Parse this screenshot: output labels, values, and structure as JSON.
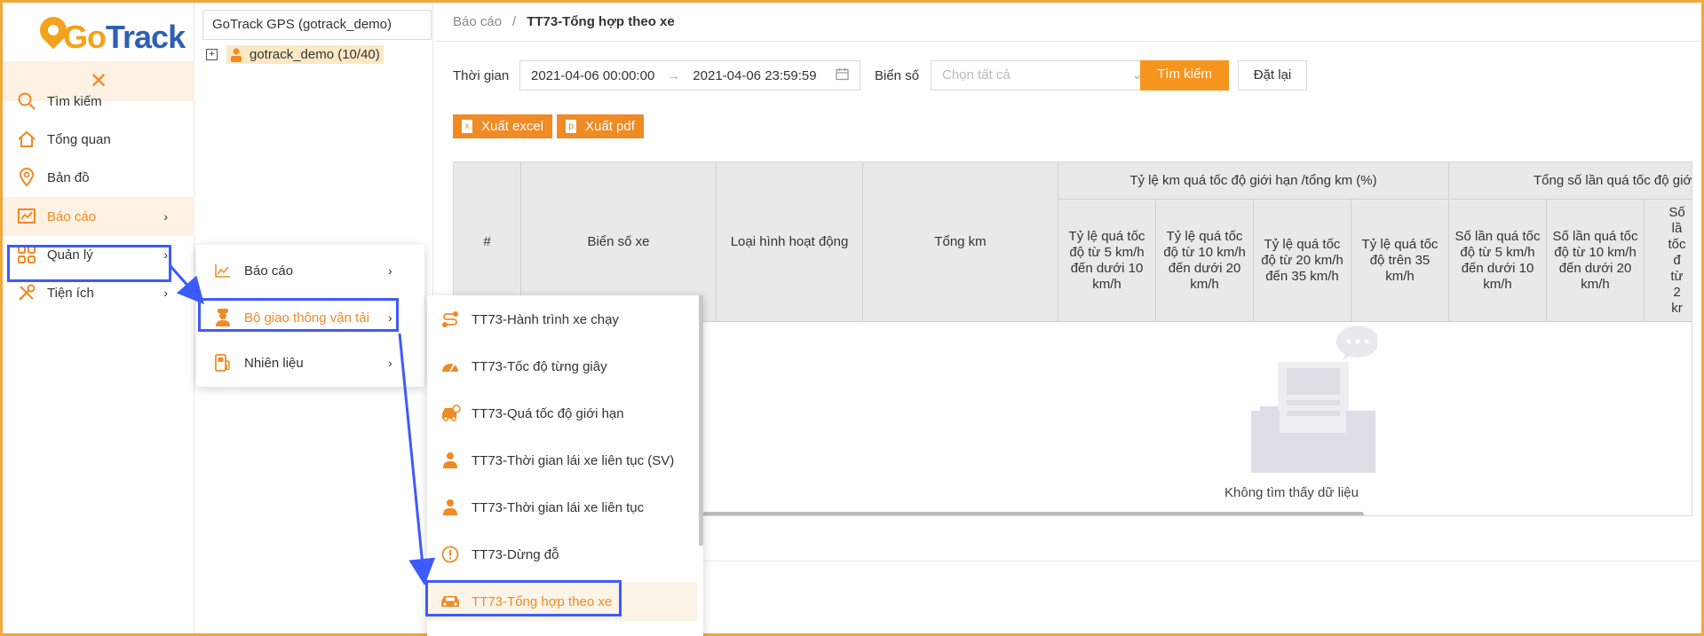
{
  "brand": {
    "logo_text": "GoTrack",
    "accent": "#f08a24",
    "highlight_box": "#3d5afe"
  },
  "sidebar": {
    "close_icon": "close-icon",
    "items": [
      {
        "label": "Tìm kiếm",
        "icon": "search-icon"
      },
      {
        "label": "Tổng quan",
        "icon": "home-icon"
      },
      {
        "label": "Bản đồ",
        "icon": "map-pin-icon"
      },
      {
        "label": "Báo cáo",
        "icon": "chart-icon",
        "active": true
      },
      {
        "label": "Quản lý",
        "icon": "grid-icon"
      },
      {
        "label": "Tiện ích",
        "icon": "tools-icon"
      }
    ]
  },
  "tree": {
    "account": "GoTrack GPS (gotrack_demo)",
    "node": "gotrack_demo (10/40)"
  },
  "breadcrumb": {
    "parent": "Báo cáo",
    "separator": "/",
    "current": "TT73-Tổng hợp theo xe"
  },
  "filters": {
    "time_label": "Thời gian",
    "date_from": "2021-04-06 00:00:00",
    "date_to": "2021-04-06 23:59:59",
    "plate_label": "Biển số",
    "plate_placeholder": "Chọn tất cả",
    "search_button": "Tìm kiếm",
    "reset_button": "Đặt lại"
  },
  "exports": {
    "excel": "Xuất excel",
    "pdf": "Xuất pdf"
  },
  "table": {
    "col_index": "#",
    "col_plate": "Biển số xe",
    "col_type": "Loại hình hoạt động",
    "col_total_km": "Tổng km",
    "group1": "Tỷ lệ km quá tốc độ giới hạn /tổng km (%)",
    "group1_cols": [
      "Tỷ lệ quá tốc độ từ 5 km/h đến dưới 10 km/h",
      "Tỷ lệ quá tốc độ từ 10 km/h đến dưới 20 km/h",
      "Tỷ lệ quá tốc độ từ 20 km/h đến 35 km/h",
      "Tỷ lệ quá tốc độ trên 35 km/h"
    ],
    "group2": "Tổng số lần quá tốc độ giớ",
    "group2_cols": [
      "Số lần quá tốc độ từ 5 km/h đến dưới 10 km/h",
      "Số lần quá tốc độ từ 10 km/h đến dưới 20 km/h",
      "Số lầ tốc đ từ 2 kr"
    ],
    "empty_text": "Không tìm thấy dữ liệu"
  },
  "submenu1": {
    "items": [
      {
        "label": "Báo cáo",
        "icon": "line-chart-icon"
      },
      {
        "label": "Bộ giao thông vận tải",
        "icon": "officer-icon",
        "active": true
      },
      {
        "label": "Nhiên liệu",
        "icon": "fuel-icon"
      }
    ]
  },
  "submenu2": {
    "items": [
      {
        "label": "TT73-Hành trình xe chạy",
        "icon": "route-icon"
      },
      {
        "label": "TT73-Tốc độ từng giây",
        "icon": "speedometer-icon"
      },
      {
        "label": "TT73-Quá tốc độ giới hạn",
        "icon": "car-speed-icon"
      },
      {
        "label": "TT73-Thời gian lái xe liên tục (SV)",
        "icon": "driver-icon"
      },
      {
        "label": "TT73-Thời gian lái xe liên tục",
        "icon": "driver-icon"
      },
      {
        "label": "TT73-Dừng đỗ",
        "icon": "alert-icon"
      },
      {
        "label": "TT73-Tổng hợp theo xe",
        "icon": "car-icon",
        "active": true
      }
    ]
  }
}
